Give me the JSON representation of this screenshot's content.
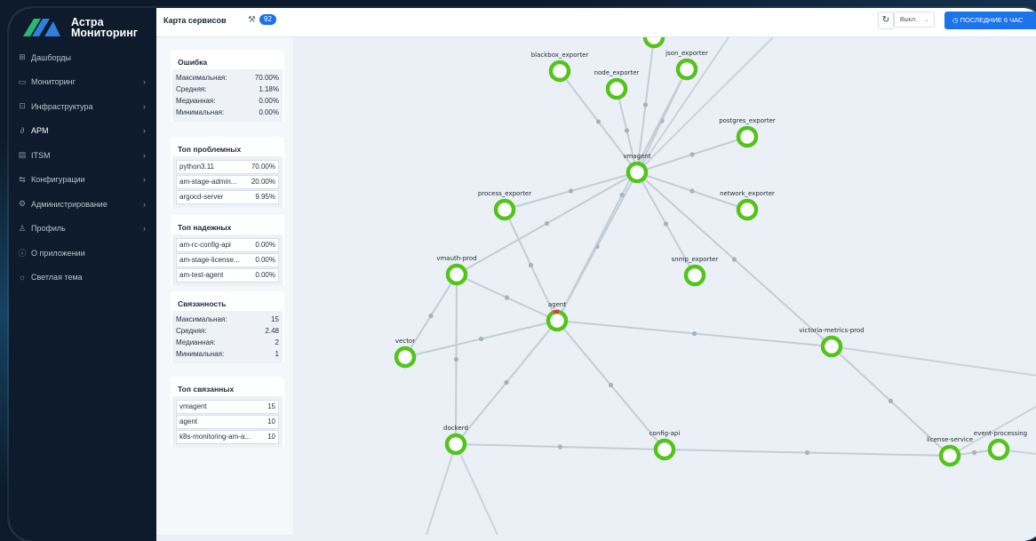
{
  "app": {
    "logo_line1": "Астра",
    "logo_line2": "Мониторинг"
  },
  "sidebar": {
    "items": [
      {
        "icon": "dashboard-icon",
        "glyph": "⊞",
        "label": "Дашборды",
        "chevron": false
      },
      {
        "icon": "monitor-icon",
        "glyph": "▭",
        "label": "Мониторинг",
        "chevron": true
      },
      {
        "icon": "infrastructure-icon",
        "glyph": "⊡",
        "label": "Инфраструктура",
        "chevron": true
      },
      {
        "icon": "apm-icon",
        "glyph": "∂",
        "label": "APM",
        "chevron": true,
        "active": true
      },
      {
        "icon": "itsm-icon",
        "glyph": "▤",
        "label": "ITSM",
        "chevron": true
      },
      {
        "icon": "config-icon",
        "glyph": "⇆",
        "label": "Конфигурации",
        "chevron": true
      },
      {
        "icon": "admin-gear-icon",
        "glyph": "⚙",
        "label": "Администрирование",
        "chevron": true
      },
      {
        "icon": "user-icon",
        "glyph": "♙",
        "label": "Профиль",
        "chevron": true
      },
      {
        "icon": "info-icon",
        "glyph": "ⓘ",
        "label": "О приложении",
        "chevron": false
      },
      {
        "icon": "sun-icon",
        "glyph": "☼",
        "label": "Светлая тема",
        "chevron": false
      }
    ]
  },
  "header": {
    "title": "Карта сервисов",
    "count": "92",
    "refresh_icon": "refresh-icon",
    "refresh_select": "Выкл.",
    "time_button": "ПОСЛЕДНИЕ 6 ЧАС"
  },
  "stats": {
    "error": {
      "title": "Ошибка",
      "rows": [
        {
          "k": "Максимальная:",
          "v": "70.00%"
        },
        {
          "k": "Средняя:",
          "v": "1.18%"
        },
        {
          "k": "Медианная:",
          "v": "0.00%"
        },
        {
          "k": "Минимальная:",
          "v": "0.00%"
        }
      ]
    },
    "top_problem": {
      "title": "Топ проблемных",
      "rows": [
        {
          "k": "python3.11",
          "v": "70.00%"
        },
        {
          "k": "am-stage-admin...",
          "v": "20.00%"
        },
        {
          "k": "argocd-server",
          "v": "9.95%"
        }
      ]
    },
    "top_reliable": {
      "title": "Топ надежных",
      "rows": [
        {
          "k": "am-rc-config-api",
          "v": "0.00%"
        },
        {
          "k": "am-stage-license...",
          "v": "0.00%"
        },
        {
          "k": "am-test-agent",
          "v": "0.00%"
        }
      ]
    },
    "connectivity": {
      "title": "Связанность",
      "rows": [
        {
          "k": "Максимальная:",
          "v": "15"
        },
        {
          "k": "Средняя:",
          "v": "2.48"
        },
        {
          "k": "Медианная:",
          "v": "2"
        },
        {
          "k": "Минимальная:",
          "v": "1"
        }
      ]
    },
    "top_connected": {
      "title": "Топ связанных",
      "rows": [
        {
          "k": "vmagent",
          "v": "15"
        },
        {
          "k": "agent",
          "v": "10"
        },
        {
          "k": "k8s-monitoring-am-a...",
          "v": "10"
        }
      ]
    }
  },
  "map": {
    "node_color": "#52c41a",
    "alert_color": "#e53935",
    "nodes": [
      {
        "id": "top",
        "label": ""
      },
      {
        "id": "blackbox_exporter",
        "label": "blackbox_exporter"
      },
      {
        "id": "node_exporter",
        "label": "node_exporter"
      },
      {
        "id": "json_exporter",
        "label": "json_exporter"
      },
      {
        "id": "postgres_exporter",
        "label": "postgres_exporter"
      },
      {
        "id": "vmagent",
        "label": "vmagent"
      },
      {
        "id": "process_exporter",
        "label": "process_exporter"
      },
      {
        "id": "network_exporter",
        "label": "network_exporter"
      },
      {
        "id": "vmauth-prod",
        "label": "vmauth-prod"
      },
      {
        "id": "snmp_exporter",
        "label": "snmp_exporter"
      },
      {
        "id": "agent",
        "label": "agent",
        "alert": true
      },
      {
        "id": "vector",
        "label": "vector"
      },
      {
        "id": "victoria-metrics-prod",
        "label": "victoria-metrics-prod"
      },
      {
        "id": "dockerd",
        "label": "dockerd"
      },
      {
        "id": "config-api",
        "label": "config-api"
      },
      {
        "id": "license-service",
        "label": "license-service"
      },
      {
        "id": "event-processing",
        "label": "event-processing"
      }
    ],
    "edges": [
      [
        "vmagent",
        "blackbox_exporter"
      ],
      [
        "vmagent",
        "node_exporter"
      ],
      [
        "vmagent",
        "json_exporter"
      ],
      [
        "vmagent",
        "top"
      ],
      [
        "vmagent",
        "postgres_exporter"
      ],
      [
        "vmagent",
        "process_exporter"
      ],
      [
        "vmagent",
        "network_exporter"
      ],
      [
        "vmagent",
        "snmp_exporter"
      ],
      [
        "vmagent",
        "vmauth-prod"
      ],
      [
        "vmagent",
        "agent"
      ],
      [
        "vmagent",
        "victoria-metrics-prod"
      ],
      [
        "agent",
        "process_exporter"
      ],
      [
        "agent",
        "vmauth-prod"
      ],
      [
        "agent",
        "vector"
      ],
      [
        "agent",
        "victoria-metrics-prod"
      ],
      [
        "agent",
        "dockerd"
      ],
      [
        "agent",
        "config-api"
      ],
      [
        "agent",
        "json_exporter"
      ],
      [
        "vmauth-prod",
        "vector"
      ],
      [
        "vmauth-prod",
        "dockerd"
      ],
      [
        "dockerd",
        "config-api"
      ],
      [
        "config-api",
        "license-service"
      ],
      [
        "victoria-metrics-prod",
        "license-service"
      ],
      [
        "license-service",
        "event-processing"
      ]
    ]
  }
}
